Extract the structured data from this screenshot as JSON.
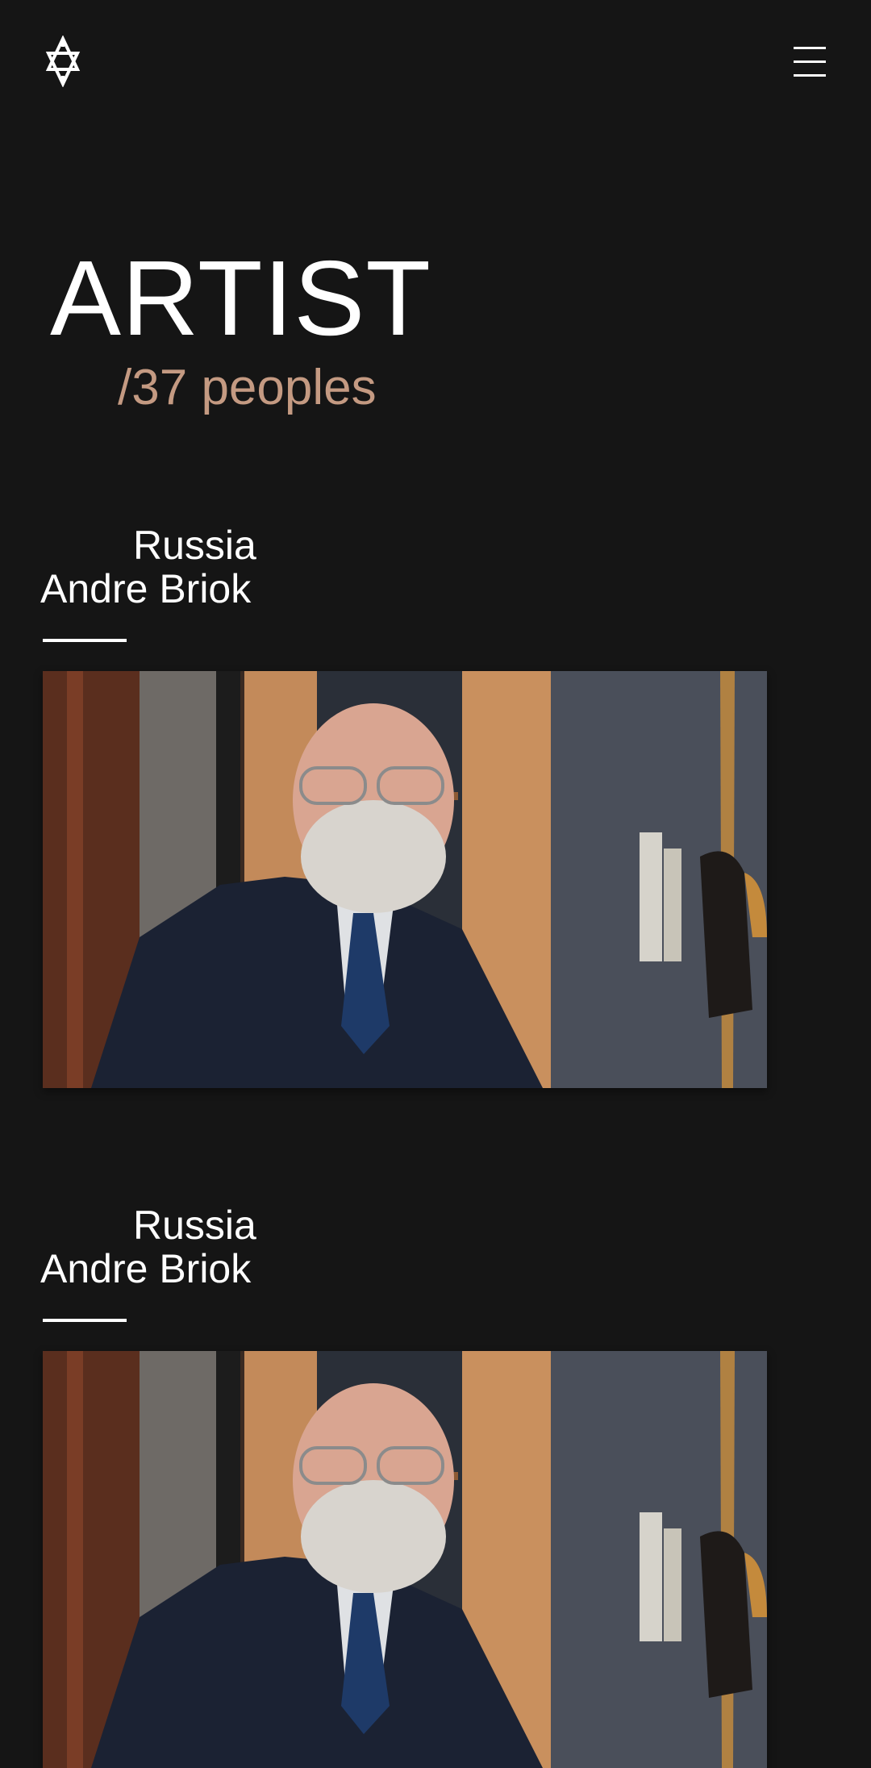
{
  "header": {
    "logo_icon": "av-monogram-logo",
    "menu_icon": "hamburger-menu-icon"
  },
  "page": {
    "title": "ARTIST",
    "count_slash": "/",
    "count_number": "37",
    "count_label": "peoples"
  },
  "artists": [
    {
      "country": "Russia",
      "name": "Andre Briok",
      "photo_icon": "artist-portrait-photo"
    },
    {
      "country": "Russia",
      "name": "Andre Briok",
      "photo_icon": "artist-portrait-photo"
    }
  ],
  "colors": {
    "background": "#151515",
    "text": "#ffffff",
    "accent": "#c49a82"
  }
}
